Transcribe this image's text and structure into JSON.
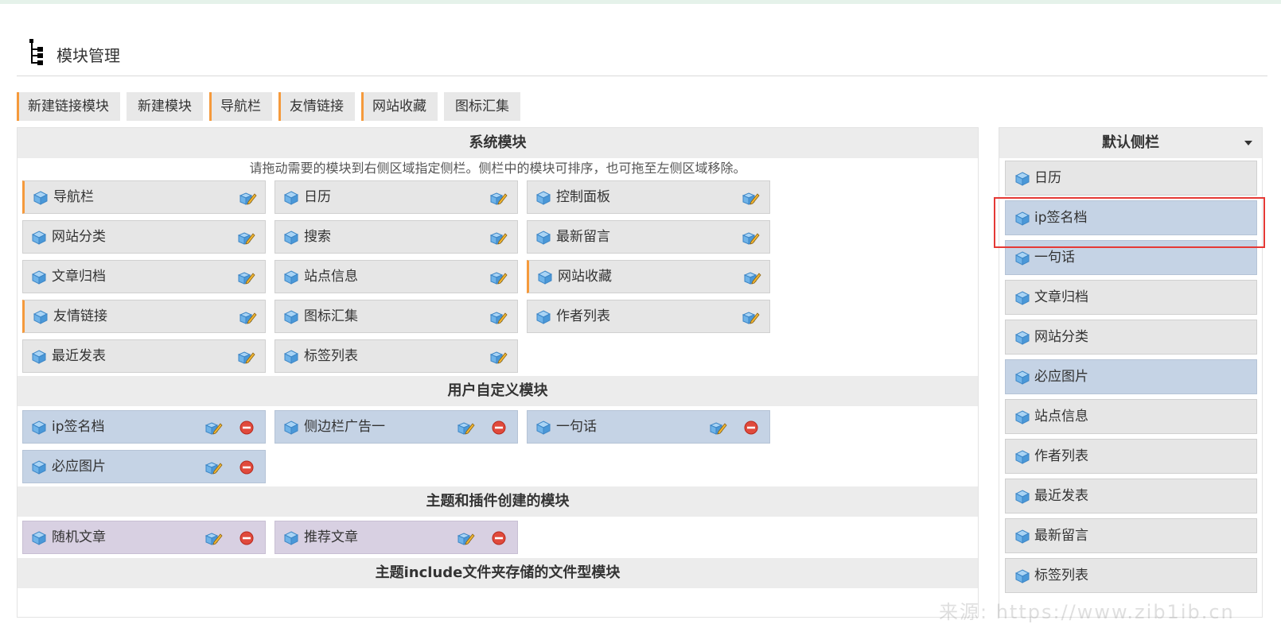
{
  "page": {
    "title": "模块管理"
  },
  "toolbar": {
    "buttons": [
      "新建链接模块",
      "新建模块",
      "导航栏",
      "友情链接",
      "网站收藏",
      "图标汇集"
    ]
  },
  "left_panel": {
    "system": {
      "title": "系统模块",
      "hint": "请拖动需要的模块到右侧区域指定侧栏。侧栏中的模块可排序，也可拖至左侧区域移除。",
      "modules": [
        "导航栏",
        "日历",
        "控制面板",
        "网站分类",
        "搜索",
        "最新留言",
        "文章归档",
        "站点信息",
        "网站收藏",
        "友情链接",
        "图标汇集",
        "作者列表",
        "最近发表",
        "标签列表"
      ]
    },
    "user": {
      "title": "用户自定义模块",
      "modules": [
        "ip签名档",
        "侧边栏广告一",
        "一句话",
        "必应图片"
      ]
    },
    "theme": {
      "title": "主题和插件创建的模块",
      "modules": [
        "随机文章",
        "推荐文章"
      ]
    },
    "files": {
      "title": "主题include文件夹存储的文件型模块"
    }
  },
  "right_panel": {
    "title": "默认侧栏",
    "items": [
      "日历",
      "ip签名档",
      "一句话",
      "文章归档",
      "网站分类",
      "必应图片",
      "站点信息",
      "作者列表",
      "最近发表",
      "最新留言",
      "标签列表"
    ]
  },
  "watermark": "来源: https://www.zib1ib.cn",
  "colors": {
    "accent": "#f59a3c",
    "system_module": "#e6e6e6",
    "user_module": "#c5d3e5",
    "theme_module": "#d8d0e2",
    "highlight": "#e53935"
  }
}
